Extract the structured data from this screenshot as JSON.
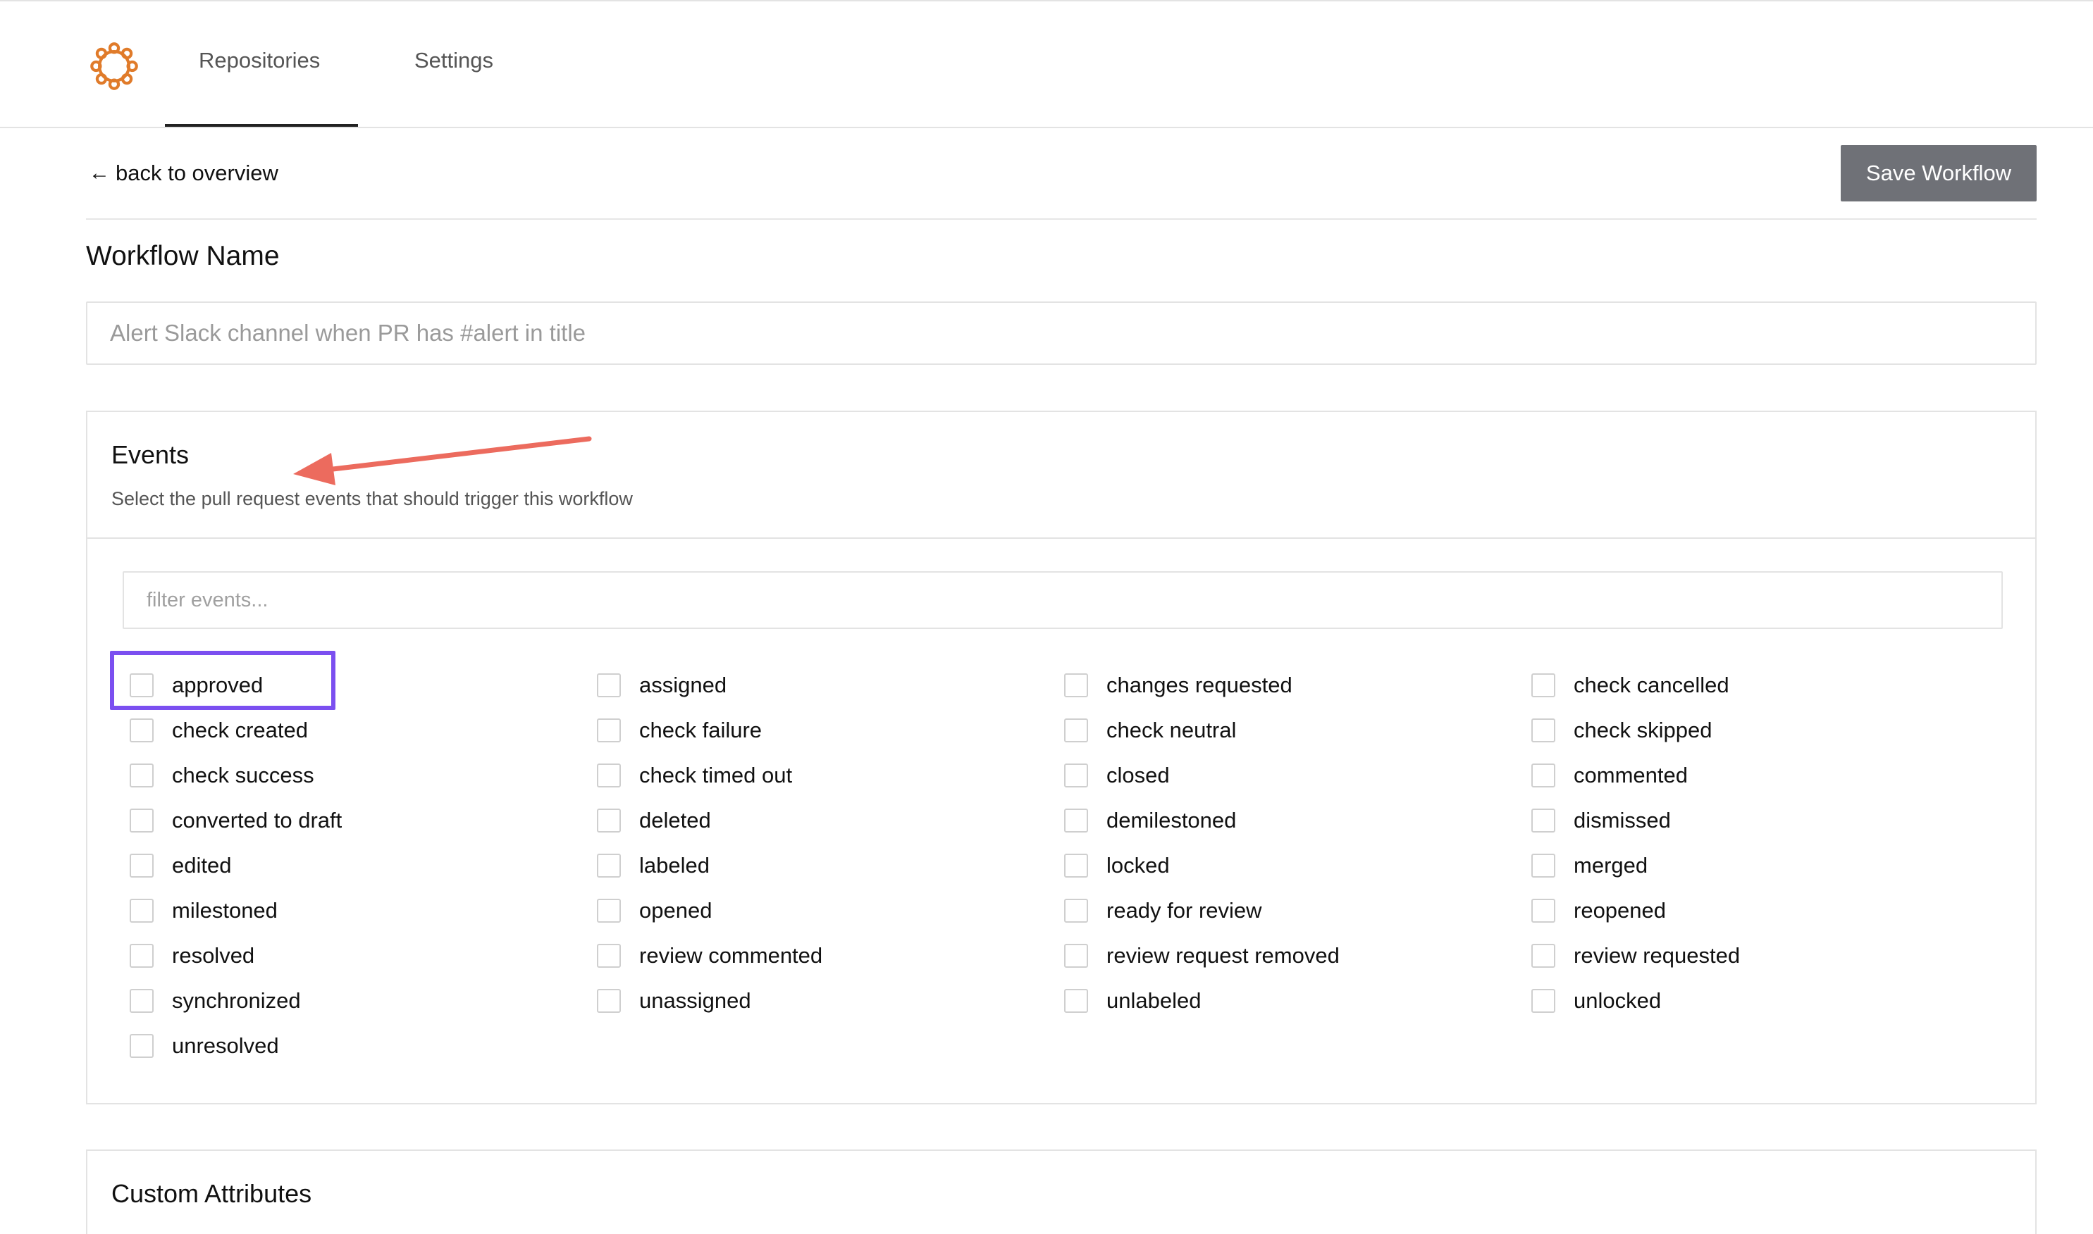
{
  "nav": {
    "logo": "logo-icon",
    "tabs": [
      {
        "label": "Repositories",
        "active": true
      },
      {
        "label": "Settings",
        "active": false
      }
    ]
  },
  "toolbar": {
    "back_label": "back to overview",
    "back_icon": "arrow-left-icon",
    "save_label": "Save Workflow"
  },
  "workflow_name": {
    "title": "Workflow Name",
    "placeholder": "Alert Slack channel when PR has #alert in title"
  },
  "events": {
    "title": "Events",
    "description": "Select the pull request events that should trigger this workflow",
    "filter_placeholder": "filter events...",
    "items": [
      {
        "label": "approved",
        "checked": false
      },
      {
        "label": "assigned",
        "checked": false
      },
      {
        "label": "changes requested",
        "checked": false
      },
      {
        "label": "check cancelled",
        "checked": false
      },
      {
        "label": "check created",
        "checked": false
      },
      {
        "label": "check failure",
        "checked": false
      },
      {
        "label": "check neutral",
        "checked": false
      },
      {
        "label": "check skipped",
        "checked": false
      },
      {
        "label": "check success",
        "checked": false
      },
      {
        "label": "check timed out",
        "checked": false
      },
      {
        "label": "closed",
        "checked": false
      },
      {
        "label": "commented",
        "checked": false
      },
      {
        "label": "converted to draft",
        "checked": false
      },
      {
        "label": "deleted",
        "checked": false
      },
      {
        "label": "demilestoned",
        "checked": false
      },
      {
        "label": "dismissed",
        "checked": false
      },
      {
        "label": "edited",
        "checked": false
      },
      {
        "label": "labeled",
        "checked": false
      },
      {
        "label": "locked",
        "checked": false
      },
      {
        "label": "merged",
        "checked": false
      },
      {
        "label": "milestoned",
        "checked": false
      },
      {
        "label": "opened",
        "checked": false
      },
      {
        "label": "ready for review",
        "checked": false
      },
      {
        "label": "reopened",
        "checked": false
      },
      {
        "label": "resolved",
        "checked": false
      },
      {
        "label": "review commented",
        "checked": false
      },
      {
        "label": "review request removed",
        "checked": false
      },
      {
        "label": "review requested",
        "checked": false
      },
      {
        "label": "synchronized",
        "checked": false
      },
      {
        "label": "unassigned",
        "checked": false
      },
      {
        "label": "unlabeled",
        "checked": false
      },
      {
        "label": "unlocked",
        "checked": false
      },
      {
        "label": "unresolved",
        "checked": false
      }
    ]
  },
  "custom_attributes": {
    "title": "Custom Attributes"
  },
  "annotations": {
    "arrow_color": "#ec6b5e",
    "highlight_color": "#7b4ff0"
  }
}
